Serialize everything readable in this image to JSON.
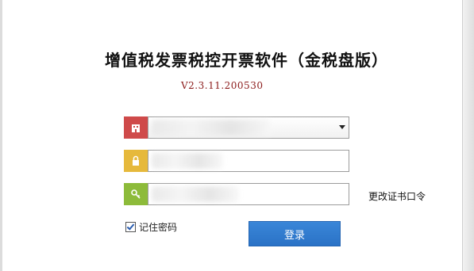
{
  "title": "增值税发票税控开票软件（金税盘版）",
  "version": "V2.3.11.200530",
  "taxpayer_select": {
    "value": ""
  },
  "certificate_password": {
    "value": ""
  },
  "user_password": {
    "value": ""
  },
  "change_password_link": "更改证书口令",
  "remember_password": {
    "label": "记住密码",
    "checked": true
  },
  "login_button": "登录",
  "colors": {
    "icon_red": "#cf4a4a",
    "icon_yellow": "#e6b93c",
    "icon_green": "#8dbb3a",
    "login_button": "#2a72c6",
    "version_text": "#8b1a1a"
  },
  "icons": {
    "taxpayer": "building-icon",
    "certificate": "lock-icon",
    "password": "key-icon",
    "dropdown": "chevron-down-icon"
  }
}
